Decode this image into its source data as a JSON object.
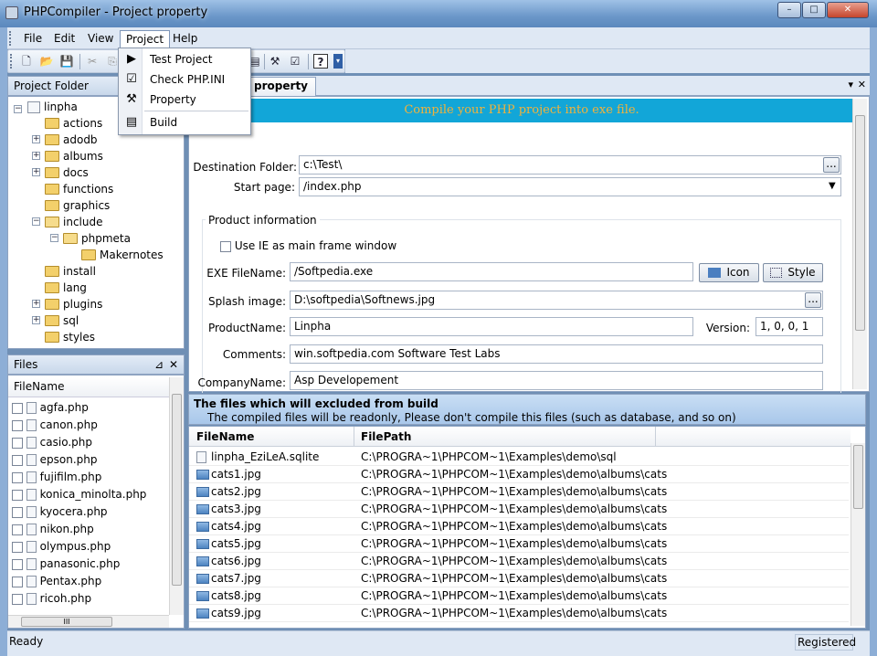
{
  "window": {
    "title": "PHPCompiler - Project property",
    "min": "–",
    "max": "□",
    "close": "✕"
  },
  "menubar": {
    "items": [
      "File",
      "Edit",
      "View",
      "Project",
      "Help"
    ]
  },
  "project_menu": {
    "items": [
      "Test Project",
      "Check PHP.INI",
      "Property",
      "Build"
    ]
  },
  "project_folder": {
    "title": "Project Folder",
    "root": "linpha",
    "items": [
      "actions",
      "adodb",
      "albums",
      "docs",
      "functions",
      "graphics",
      "include",
      "phpmeta",
      "Makernotes",
      "install",
      "lang",
      "plugins",
      "sql",
      "styles"
    ]
  },
  "files_panel": {
    "title": "Files",
    "pin": "⊿",
    "close": "✕",
    "column": "FileName",
    "files": [
      "agfa.php",
      "canon.php",
      "casio.php",
      "epson.php",
      "fujifilm.php",
      "konica_minolta.php",
      "kyocera.php",
      "nikon.php",
      "olympus.php",
      "panasonic.php",
      "Pentax.php",
      "ricoh.php"
    ],
    "hscroll": "III"
  },
  "document_tab": {
    "label": "Project property",
    "label_visible": "ct property",
    "pin": "▾",
    "close": "✕"
  },
  "form": {
    "banner": "Compile your PHP project into exe file.",
    "destination_label": "Destination Folder:",
    "destination_value": "c:\\Test\\",
    "browse": "...",
    "start_label": "Start page:",
    "start_value": "/index.php",
    "group_label": "Product information",
    "use_ie_label": "Use IE as main frame window",
    "exe_label": "EXE FileName:",
    "exe_value": "/Softpedia.exe",
    "icon_button": "Icon",
    "style_button": "Style",
    "splash_label": "Splash image:",
    "splash_value": "D:\\softpedia\\Softnews.jpg",
    "product_label": "ProductName:",
    "product_value": "Linpha",
    "version_label": "Version:",
    "version_value": "1, 0, 0, 1",
    "comments_label": "Comments:",
    "comments_value": "win.softpedia.com Software Test Labs",
    "company_label": "CompanyName:",
    "company_value": "Asp Developement"
  },
  "excluded": {
    "title": "The files which will excluded from build",
    "subtitle": "The compiled files will be readonly, Please don't compile this files (such as database, and so on)",
    "columns": [
      "FileName",
      "FilePath"
    ],
    "rows": [
      [
        "linpha_EziLeA.sqlite",
        "C:\\PROGRA~1\\PHPCOM~1\\Examples\\demo\\sql"
      ],
      [
        "cats1.jpg",
        "C:\\PROGRA~1\\PHPCOM~1\\Examples\\demo\\albums\\cats"
      ],
      [
        "cats2.jpg",
        "C:\\PROGRA~1\\PHPCOM~1\\Examples\\demo\\albums\\cats"
      ],
      [
        "cats3.jpg",
        "C:\\PROGRA~1\\PHPCOM~1\\Examples\\demo\\albums\\cats"
      ],
      [
        "cats4.jpg",
        "C:\\PROGRA~1\\PHPCOM~1\\Examples\\demo\\albums\\cats"
      ],
      [
        "cats5.jpg",
        "C:\\PROGRA~1\\PHPCOM~1\\Examples\\demo\\albums\\cats"
      ],
      [
        "cats6.jpg",
        "C:\\PROGRA~1\\PHPCOM~1\\Examples\\demo\\albums\\cats"
      ],
      [
        "cats7.jpg",
        "C:\\PROGRA~1\\PHPCOM~1\\Examples\\demo\\albums\\cats"
      ],
      [
        "cats8.jpg",
        "C:\\PROGRA~1\\PHPCOM~1\\Examples\\demo\\albums\\cats"
      ],
      [
        "cats9.jpg",
        "C:\\PROGRA~1\\PHPCOM~1\\Examples\\demo\\albums\\cats"
      ]
    ]
  },
  "statusbar": {
    "left": "Ready",
    "right": "Registered"
  },
  "colors": {
    "banner_bg": "#12a6d8",
    "banner_text": "#f3b23a",
    "section_header": "#b9d3f0"
  }
}
